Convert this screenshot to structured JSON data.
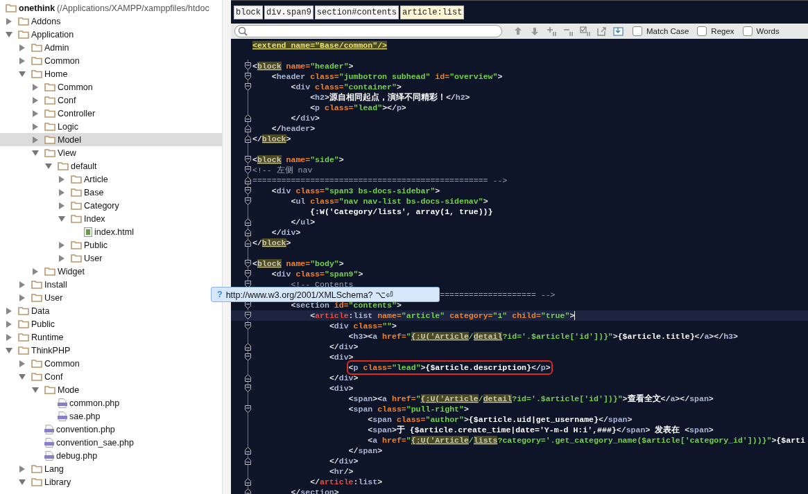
{
  "project_tree": {
    "root": {
      "name": "onethink",
      "path": "(/Applications/XAMPP/xamppfiles/htdoc"
    },
    "items": [
      {
        "name": "Addons",
        "kind": "folder",
        "expanded": false,
        "selected": false
      },
      {
        "name": "Application",
        "kind": "folder",
        "expanded": true,
        "selected": false,
        "children": [
          {
            "name": "Admin",
            "kind": "folder",
            "expanded": false,
            "selected": false
          },
          {
            "name": "Common",
            "kind": "folder",
            "expanded": false,
            "selected": false
          },
          {
            "name": "Home",
            "kind": "folder",
            "expanded": true,
            "selected": false,
            "children": [
              {
                "name": "Common",
                "kind": "folder",
                "expanded": false,
                "selected": false
              },
              {
                "name": "Conf",
                "kind": "folder",
                "expanded": false,
                "selected": false
              },
              {
                "name": "Controller",
                "kind": "folder",
                "expanded": false,
                "selected": false
              },
              {
                "name": "Logic",
                "kind": "folder",
                "expanded": false,
                "selected": false
              },
              {
                "name": "Model",
                "kind": "folder",
                "expanded": false,
                "selected": true
              },
              {
                "name": "View",
                "kind": "folder",
                "expanded": true,
                "selected": false,
                "children": [
                  {
                    "name": "default",
                    "kind": "folder",
                    "expanded": true,
                    "selected": false,
                    "children": [
                      {
                        "name": "Article",
                        "kind": "folder",
                        "expanded": false,
                        "selected": false
                      },
                      {
                        "name": "Base",
                        "kind": "folder",
                        "expanded": false,
                        "selected": false
                      },
                      {
                        "name": "Category",
                        "kind": "folder",
                        "expanded": false,
                        "selected": false
                      },
                      {
                        "name": "Index",
                        "kind": "folder",
                        "expanded": true,
                        "selected": false,
                        "children": [
                          {
                            "name": "index.html",
                            "kind": "html",
                            "selected": false
                          }
                        ]
                      },
                      {
                        "name": "Public",
                        "kind": "folder",
                        "expanded": false,
                        "selected": false
                      },
                      {
                        "name": "User",
                        "kind": "folder",
                        "expanded": false,
                        "selected": false
                      }
                    ]
                  }
                ]
              },
              {
                "name": "Widget",
                "kind": "folder",
                "expanded": false,
                "selected": false
              }
            ]
          },
          {
            "name": "Install",
            "kind": "folder",
            "expanded": false,
            "selected": false
          },
          {
            "name": "User",
            "kind": "folder",
            "expanded": false,
            "selected": false
          }
        ]
      },
      {
        "name": "Data",
        "kind": "folder",
        "expanded": false,
        "selected": false
      },
      {
        "name": "Public",
        "kind": "folder",
        "expanded": false,
        "selected": false
      },
      {
        "name": "Runtime",
        "kind": "folder",
        "expanded": false,
        "selected": false
      },
      {
        "name": "ThinkPHP",
        "kind": "folder",
        "expanded": true,
        "selected": false,
        "children": [
          {
            "name": "Common",
            "kind": "folder",
            "expanded": false,
            "selected": false
          },
          {
            "name": "Conf",
            "kind": "folder",
            "expanded": true,
            "selected": false,
            "children": [
              {
                "name": "Mode",
                "kind": "folder",
                "expanded": true,
                "selected": false,
                "children": [
                  {
                    "name": "common.php",
                    "kind": "php",
                    "selected": false
                  },
                  {
                    "name": "sae.php",
                    "kind": "php",
                    "selected": false
                  }
                ]
              },
              {
                "name": "convention.php",
                "kind": "php",
                "selected": false
              },
              {
                "name": "convention_sae.php",
                "kind": "php",
                "selected": false
              },
              {
                "name": "debug.php",
                "kind": "php",
                "selected": false
              }
            ]
          },
          {
            "name": "Lang",
            "kind": "folder",
            "expanded": false,
            "selected": false
          },
          {
            "name": "Library",
            "kind": "folder",
            "expanded": true,
            "selected": false
          }
        ]
      }
    ]
  },
  "breadcrumbs": [
    {
      "label": "block",
      "selected": false
    },
    {
      "label": "div.span9",
      "selected": false
    },
    {
      "label": "section#contents",
      "selected": false
    },
    {
      "label": "article:list",
      "selected": true
    }
  ],
  "find_bar": {
    "options": [
      {
        "label": "Match Case",
        "checked": false
      },
      {
        "label": "Regex",
        "checked": false
      },
      {
        "label": "Words",
        "checked": false
      }
    ]
  },
  "code_lines": [
    {
      "kind": "code",
      "fold_start": false,
      "fold_end": false,
      "current": false,
      "boxed": false,
      "tokens": [
        {
          "kind": "hl",
          "text": "<extend name=\"Base/common\"/>"
        }
      ]
    },
    {
      "kind": "blank",
      "fold_start": false,
      "fold_end": false,
      "current": false,
      "boxed": false
    },
    {
      "kind": "code",
      "fold_start": true,
      "fold_end": false,
      "current": false,
      "boxed": false,
      "tokens": [
        {
          "kind": "p",
          "text": "<"
        },
        {
          "kind": "ref",
          "text": "block"
        },
        {
          "kind": "attr",
          "text": " name="
        },
        {
          "kind": "str",
          "text": "\"header\""
        },
        {
          "kind": "p",
          "text": ">"
        }
      ]
    },
    {
      "kind": "code",
      "fold_start": true,
      "fold_end": false,
      "current": false,
      "boxed": false,
      "tokens": [
        {
          "kind": "p",
          "text": "    <"
        },
        {
          "kind": "tag",
          "text": "header"
        },
        {
          "kind": "attr",
          "text": " class="
        },
        {
          "kind": "str",
          "text": "\"jumbotron subhead\""
        },
        {
          "kind": "attr",
          "text": " id="
        },
        {
          "kind": "str",
          "text": "\"overview\""
        },
        {
          "kind": "p",
          "text": ">"
        }
      ]
    },
    {
      "kind": "code",
      "fold_start": true,
      "fold_end": false,
      "current": false,
      "boxed": false,
      "tokens": [
        {
          "kind": "p",
          "text": "        <"
        },
        {
          "kind": "tag",
          "text": "div"
        },
        {
          "kind": "attr",
          "text": " class="
        },
        {
          "kind": "str",
          "text": "\"container\""
        },
        {
          "kind": "p",
          "text": ">"
        }
      ]
    },
    {
      "kind": "code",
      "fold_start": false,
      "fold_end": false,
      "current": false,
      "boxed": false,
      "tokens": [
        {
          "kind": "p",
          "text": "            <"
        },
        {
          "kind": "tag",
          "text": "h2"
        },
        {
          "kind": "p",
          "text": ">"
        },
        {
          "kind": "txt",
          "text": "源自相同起点，演绎不同精彩！"
        },
        {
          "kind": "p",
          "text": "</"
        },
        {
          "kind": "tag",
          "text": "h2"
        },
        {
          "kind": "p",
          "text": ">"
        }
      ]
    },
    {
      "kind": "code",
      "fold_start": false,
      "fold_end": false,
      "current": false,
      "boxed": false,
      "tokens": [
        {
          "kind": "p",
          "text": "            <"
        },
        {
          "kind": "tag",
          "text": "p"
        },
        {
          "kind": "attr",
          "text": " class="
        },
        {
          "kind": "str",
          "text": "\"lead\""
        },
        {
          "kind": "p",
          "text": "></"
        },
        {
          "kind": "tag",
          "text": "p"
        },
        {
          "kind": "p",
          "text": ">"
        }
      ]
    },
    {
      "kind": "code",
      "fold_start": false,
      "fold_end": true,
      "current": false,
      "boxed": false,
      "tokens": [
        {
          "kind": "p",
          "text": "        </"
        },
        {
          "kind": "tag",
          "text": "div"
        },
        {
          "kind": "p",
          "text": ">"
        }
      ]
    },
    {
      "kind": "code",
      "fold_start": false,
      "fold_end": true,
      "current": false,
      "boxed": false,
      "tokens": [
        {
          "kind": "p",
          "text": "    </"
        },
        {
          "kind": "tag",
          "text": "header"
        },
        {
          "kind": "p",
          "text": ">"
        }
      ]
    },
    {
      "kind": "code",
      "fold_start": false,
      "fold_end": true,
      "current": false,
      "boxed": false,
      "tokens": [
        {
          "kind": "p",
          "text": "</"
        },
        {
          "kind": "ref",
          "text": "block"
        },
        {
          "kind": "p",
          "text": ">"
        }
      ]
    },
    {
      "kind": "blank",
      "fold_start": false,
      "fold_end": false,
      "current": false,
      "boxed": false
    },
    {
      "kind": "code",
      "fold_start": true,
      "fold_end": false,
      "current": false,
      "boxed": false,
      "tokens": [
        {
          "kind": "p",
          "text": "<"
        },
        {
          "kind": "ref",
          "text": "block"
        },
        {
          "kind": "attr",
          "text": " name="
        },
        {
          "kind": "str",
          "text": "\"side\""
        },
        {
          "kind": "p",
          "text": ">"
        }
      ]
    },
    {
      "kind": "code",
      "fold_start": true,
      "fold_end": false,
      "current": false,
      "boxed": false,
      "tokens": [
        {
          "kind": "cmt",
          "text": "<!-- 左侧 nav"
        }
      ]
    },
    {
      "kind": "code",
      "fold_start": false,
      "fold_end": true,
      "current": false,
      "boxed": false,
      "tokens": [
        {
          "kind": "cmt",
          "text": "================================================= -->"
        }
      ]
    },
    {
      "kind": "code",
      "fold_start": true,
      "fold_end": false,
      "current": false,
      "boxed": false,
      "tokens": [
        {
          "kind": "p",
          "text": "    <"
        },
        {
          "kind": "tag",
          "text": "div"
        },
        {
          "kind": "attr",
          "text": " class="
        },
        {
          "kind": "str",
          "text": "\"span3 bs-docs-sidebar\""
        },
        {
          "kind": "p",
          "text": ">"
        }
      ]
    },
    {
      "kind": "code",
      "fold_start": true,
      "fold_end": false,
      "current": false,
      "boxed": false,
      "tokens": [
        {
          "kind": "p",
          "text": "        <"
        },
        {
          "kind": "tag",
          "text": "ul"
        },
        {
          "kind": "attr",
          "text": " class="
        },
        {
          "kind": "str",
          "text": "\"nav nav-list bs-docs-sidenav\""
        },
        {
          "kind": "p",
          "text": ">"
        }
      ]
    },
    {
      "kind": "code",
      "fold_start": false,
      "fold_end": false,
      "current": false,
      "boxed": false,
      "tokens": [
        {
          "kind": "txt",
          "text": "            {:W('Category/lists', array(1, true))}"
        }
      ]
    },
    {
      "kind": "code",
      "fold_start": false,
      "fold_end": true,
      "current": false,
      "boxed": false,
      "tokens": [
        {
          "kind": "p",
          "text": "        </"
        },
        {
          "kind": "tag",
          "text": "ul"
        },
        {
          "kind": "p",
          "text": ">"
        }
      ]
    },
    {
      "kind": "code",
      "fold_start": false,
      "fold_end": true,
      "current": false,
      "boxed": false,
      "tokens": [
        {
          "kind": "p",
          "text": "    </"
        },
        {
          "kind": "tag",
          "text": "div"
        },
        {
          "kind": "p",
          "text": ">"
        }
      ]
    },
    {
      "kind": "code",
      "fold_start": false,
      "fold_end": true,
      "current": false,
      "boxed": false,
      "tokens": [
        {
          "kind": "p",
          "text": "</"
        },
        {
          "kind": "ref",
          "text": "block"
        },
        {
          "kind": "p",
          "text": ">"
        }
      ]
    },
    {
      "kind": "blank",
      "fold_start": false,
      "fold_end": false,
      "current": false,
      "boxed": false
    },
    {
      "kind": "code",
      "fold_start": true,
      "fold_end": false,
      "current": false,
      "boxed": false,
      "tokens": [
        {
          "kind": "p",
          "text": "<"
        },
        {
          "kind": "ref",
          "text": "block"
        },
        {
          "kind": "attr",
          "text": " name="
        },
        {
          "kind": "str",
          "text": "\"body\""
        },
        {
          "kind": "p",
          "text": ">"
        }
      ]
    },
    {
      "kind": "code",
      "fold_start": true,
      "fold_end": false,
      "current": false,
      "boxed": false,
      "tokens": [
        {
          "kind": "p",
          "text": "    <"
        },
        {
          "kind": "tag",
          "text": "div"
        },
        {
          "kind": "attr",
          "text": " class="
        },
        {
          "kind": "str",
          "text": "\"span9\""
        },
        {
          "kind": "p",
          "text": ">"
        }
      ]
    },
    {
      "kind": "code",
      "fold_start": true,
      "fold_end": false,
      "current": false,
      "boxed": false,
      "tokens": [
        {
          "kind": "cmt",
          "text": "        <!-- Contents"
        }
      ]
    },
    {
      "kind": "code",
      "current": false,
      "boxed": false,
      "tokens": [
        {
          "kind": "cmt",
          "text": "                                       ==================== -->"
        }
      ]
    },
    {
      "kind": "code",
      "fold_start": true,
      "fold_end": false,
      "current": false,
      "boxed": false,
      "tokens": [
        {
          "kind": "p",
          "text": "        <"
        },
        {
          "kind": "tag",
          "text": "section"
        },
        {
          "kind": "attr",
          "text": " id="
        },
        {
          "kind": "str",
          "text": "\"contents\""
        },
        {
          "kind": "p",
          "text": ">"
        }
      ]
    },
    {
      "kind": "code",
      "fold_start": true,
      "fold_end": false,
      "current": true,
      "boxed": false,
      "tokens": [
        {
          "kind": "p",
          "text": "            <"
        },
        {
          "kind": "ns",
          "text": "article"
        },
        {
          "kind": "p",
          "text": ":"
        },
        {
          "kind": "tag",
          "text": "list"
        },
        {
          "kind": "attr",
          "text": " name="
        },
        {
          "kind": "str",
          "text": "\"article\""
        },
        {
          "kind": "attr",
          "text": " category="
        },
        {
          "kind": "str",
          "text": "\"1\""
        },
        {
          "kind": "attr",
          "text": " child="
        },
        {
          "kind": "str",
          "text": "\"true\""
        },
        {
          "kind": "p",
          "text": ">"
        }
      ]
    },
    {
      "kind": "code",
      "fold_start": true,
      "fold_end": false,
      "current": false,
      "boxed": false,
      "tokens": [
        {
          "kind": "p",
          "text": "                <"
        },
        {
          "kind": "tag",
          "text": "div"
        },
        {
          "kind": "attr",
          "text": " class="
        },
        {
          "kind": "str",
          "text": "\"\""
        },
        {
          "kind": "p",
          "text": ">"
        }
      ]
    },
    {
      "kind": "code",
      "fold_start": false,
      "fold_end": false,
      "current": false,
      "boxed": false,
      "tokens": [
        {
          "kind": "p",
          "text": "                    <"
        },
        {
          "kind": "tag",
          "text": "h3"
        },
        {
          "kind": "p",
          "text": "><"
        },
        {
          "kind": "tag",
          "text": "a"
        },
        {
          "kind": "attr",
          "text": " href="
        },
        {
          "kind": "str",
          "text": "\""
        },
        {
          "kind": "ref",
          "text": "{:U('Article"
        },
        {
          "kind": "str",
          "text": "/"
        },
        {
          "kind": "ref",
          "text": "detail"
        },
        {
          "kind": "str",
          "text": "?id='.$article['id'])}\""
        },
        {
          "kind": "p",
          "text": ">"
        },
        {
          "kind": "txt",
          "text": "{$article.title}"
        },
        {
          "kind": "p",
          "text": "</"
        },
        {
          "kind": "tag",
          "text": "a"
        },
        {
          "kind": "p",
          "text": "></"
        },
        {
          "kind": "tag",
          "text": "h3"
        },
        {
          "kind": "p",
          "text": ">"
        }
      ]
    },
    {
      "kind": "code",
      "fold_start": false,
      "fold_end": true,
      "current": false,
      "boxed": false,
      "tokens": [
        {
          "kind": "p",
          "text": "                </"
        },
        {
          "kind": "tag",
          "text": "div"
        },
        {
          "kind": "p",
          "text": ">"
        }
      ]
    },
    {
      "kind": "code",
      "fold_start": true,
      "fold_end": false,
      "current": false,
      "boxed": false,
      "tokens": [
        {
          "kind": "p",
          "text": "                <"
        },
        {
          "kind": "tag",
          "text": "div"
        },
        {
          "kind": "p",
          "text": ">"
        }
      ]
    },
    {
      "kind": "code",
      "fold_start": false,
      "fold_end": false,
      "current": false,
      "boxed": true,
      "tokens": [
        {
          "kind": "p",
          "text": "<"
        },
        {
          "kind": "tag",
          "text": "p"
        },
        {
          "kind": "attr",
          "text": " class="
        },
        {
          "kind": "str",
          "text": "\"lead\""
        },
        {
          "kind": "p",
          "text": ">"
        },
        {
          "kind": "txt",
          "text": "{$article.description}"
        },
        {
          "kind": "p",
          "text": "</"
        },
        {
          "kind": "tag",
          "text": "p"
        },
        {
          "kind": "p",
          "text": ">"
        }
      ]
    },
    {
      "kind": "code",
      "fold_start": false,
      "fold_end": true,
      "current": false,
      "boxed": false,
      "tokens": [
        {
          "kind": "p",
          "text": "                </"
        },
        {
          "kind": "tag",
          "text": "div"
        },
        {
          "kind": "p",
          "text": ">"
        }
      ]
    },
    {
      "kind": "code",
      "fold_start": true,
      "fold_end": false,
      "current": false,
      "boxed": false,
      "tokens": [
        {
          "kind": "p",
          "text": "                <"
        },
        {
          "kind": "tag",
          "text": "div"
        },
        {
          "kind": "p",
          "text": ">"
        }
      ]
    },
    {
      "kind": "code",
      "fold_start": false,
      "fold_end": false,
      "current": false,
      "boxed": false,
      "tokens": [
        {
          "kind": "p",
          "text": "                    <"
        },
        {
          "kind": "tag",
          "text": "span"
        },
        {
          "kind": "p",
          "text": "><"
        },
        {
          "kind": "tag",
          "text": "a"
        },
        {
          "kind": "attr",
          "text": " href="
        },
        {
          "kind": "str",
          "text": "\""
        },
        {
          "kind": "ref",
          "text": "{:U('Article"
        },
        {
          "kind": "str",
          "text": "/"
        },
        {
          "kind": "ref",
          "text": "detail"
        },
        {
          "kind": "str",
          "text": "?id='.$article['id'])}\""
        },
        {
          "kind": "p",
          "text": ">"
        },
        {
          "kind": "txt",
          "text": "查看全文"
        },
        {
          "kind": "p",
          "text": "</"
        },
        {
          "kind": "tag",
          "text": "a"
        },
        {
          "kind": "p",
          "text": "></"
        },
        {
          "kind": "tag",
          "text": "span"
        },
        {
          "kind": "p",
          "text": ">"
        }
      ]
    },
    {
      "kind": "code",
      "fold_start": true,
      "fold_end": false,
      "current": false,
      "boxed": false,
      "tokens": [
        {
          "kind": "p",
          "text": "                    <"
        },
        {
          "kind": "tag",
          "text": "span"
        },
        {
          "kind": "attr",
          "text": " class="
        },
        {
          "kind": "str",
          "text": "\"pull-right\""
        },
        {
          "kind": "p",
          "text": ">"
        }
      ]
    },
    {
      "kind": "code",
      "fold_start": false,
      "fold_end": false,
      "current": false,
      "boxed": false,
      "tokens": [
        {
          "kind": "p",
          "text": "                        <"
        },
        {
          "kind": "tag",
          "text": "span"
        },
        {
          "kind": "attr",
          "text": " class="
        },
        {
          "kind": "str",
          "text": "\"author\""
        },
        {
          "kind": "p",
          "text": ">"
        },
        {
          "kind": "txt",
          "text": "{$article.uid|get_username}"
        },
        {
          "kind": "p",
          "text": "</"
        },
        {
          "kind": "tag",
          "text": "span"
        },
        {
          "kind": "p",
          "text": ">"
        }
      ]
    },
    {
      "kind": "code",
      "fold_start": false,
      "fold_end": false,
      "current": false,
      "boxed": false,
      "tokens": [
        {
          "kind": "p",
          "text": "                        <"
        },
        {
          "kind": "tag",
          "text": "span"
        },
        {
          "kind": "p",
          "text": ">"
        },
        {
          "kind": "txt",
          "text": "于 {$article.create_time|date='Y-m-d H:i',###}"
        },
        {
          "kind": "p",
          "text": "</"
        },
        {
          "kind": "tag",
          "text": "span"
        },
        {
          "kind": "p",
          "text": ">"
        },
        {
          "kind": "txt",
          "text": " 发表在 "
        },
        {
          "kind": "p",
          "text": "<"
        },
        {
          "kind": "tag",
          "text": "span"
        },
        {
          "kind": "p",
          "text": ">"
        }
      ]
    },
    {
      "kind": "code",
      "fold_start": false,
      "fold_end": false,
      "current": false,
      "boxed": false,
      "tokens": [
        {
          "kind": "p",
          "text": "                        <"
        },
        {
          "kind": "tag",
          "text": "a"
        },
        {
          "kind": "attr",
          "text": " href="
        },
        {
          "kind": "str",
          "text": "\""
        },
        {
          "kind": "ref",
          "text": "{:U('Article"
        },
        {
          "kind": "str",
          "text": "/"
        },
        {
          "kind": "ref",
          "text": "lists"
        },
        {
          "kind": "str",
          "text": "?category='.get_category_name($article['category_id']))}\""
        },
        {
          "kind": "p",
          "text": ">"
        },
        {
          "kind": "txt",
          "text": "{$arti"
        }
      ]
    },
    {
      "kind": "code",
      "fold_start": false,
      "fold_end": true,
      "current": false,
      "boxed": false,
      "tokens": [
        {
          "kind": "p",
          "text": "                    </"
        },
        {
          "kind": "tag",
          "text": "span"
        },
        {
          "kind": "p",
          "text": ">"
        }
      ]
    },
    {
      "kind": "code",
      "fold_start": false,
      "fold_end": true,
      "current": false,
      "boxed": false,
      "tokens": [
        {
          "kind": "p",
          "text": "                </"
        },
        {
          "kind": "tag",
          "text": "div"
        },
        {
          "kind": "p",
          "text": ">"
        }
      ]
    },
    {
      "kind": "code",
      "fold_start": false,
      "fold_end": false,
      "current": false,
      "boxed": false,
      "tokens": [
        {
          "kind": "p",
          "text": "                <"
        },
        {
          "kind": "tag",
          "text": "hr"
        },
        {
          "kind": "p",
          "text": "/>"
        }
      ]
    },
    {
      "kind": "code",
      "fold_start": false,
      "fold_end": true,
      "current": false,
      "boxed": false,
      "tokens": [
        {
          "kind": "p",
          "text": "            </"
        },
        {
          "kind": "ns",
          "text": "article"
        },
        {
          "kind": "p",
          "text": ":"
        },
        {
          "kind": "tag",
          "text": "list"
        },
        {
          "kind": "p",
          "text": ">"
        }
      ]
    },
    {
      "kind": "code",
      "fold_start": false,
      "fold_end": true,
      "current": false,
      "boxed": false,
      "tokens": [
        {
          "kind": "p",
          "text": "        </"
        },
        {
          "kind": "tag",
          "text": "section"
        },
        {
          "kind": "p",
          "text": ">"
        }
      ]
    }
  ],
  "tooltip": {
    "icon": "?",
    "text": "http://www.w3.org/2001/XMLSchema? ⌥⏎"
  }
}
